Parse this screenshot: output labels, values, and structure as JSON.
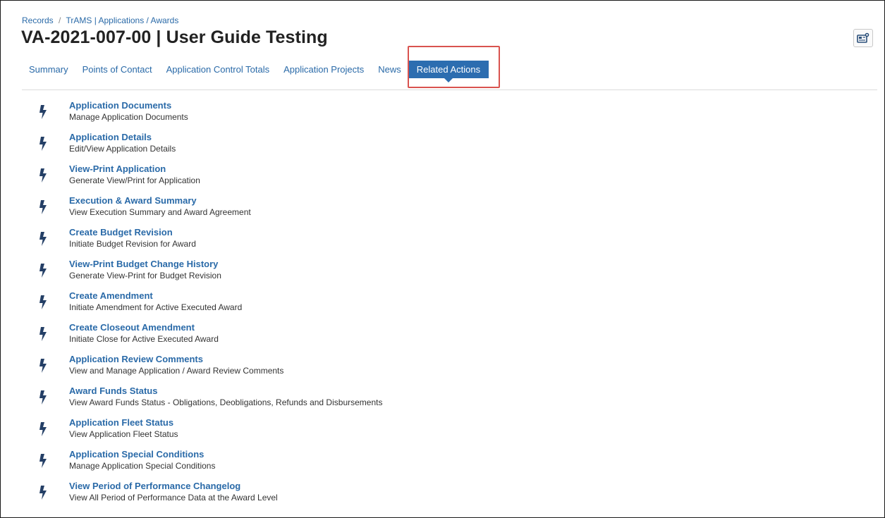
{
  "breadcrumb": {
    "items": [
      "Records",
      "TrAMS | Applications / Awards"
    ],
    "separator": "/"
  },
  "page_title": "VA-2021-007-00 | User Guide Testing",
  "news_button_icon": "news-icon",
  "tabs": [
    {
      "label": "Summary",
      "active": false
    },
    {
      "label": "Points of Contact",
      "active": false
    },
    {
      "label": "Application Control Totals",
      "active": false
    },
    {
      "label": "Application Projects",
      "active": false
    },
    {
      "label": "News",
      "active": false
    },
    {
      "label": "Related Actions",
      "active": true
    }
  ],
  "colors": {
    "link": "#2a6aa8",
    "active_tab": "#2c6db0",
    "highlight": "#d9534f",
    "bolt": "#243f66"
  },
  "related_actions": [
    {
      "title": "Application Documents",
      "description": "Manage Application Documents"
    },
    {
      "title": "Application Details",
      "description": "Edit/View Application Details"
    },
    {
      "title": "View-Print Application",
      "description": "Generate View/Print for Application"
    },
    {
      "title": "Execution & Award Summary",
      "description": "View Execution Summary and Award Agreement"
    },
    {
      "title": "Create Budget Revision",
      "description": "Initiate Budget Revision for Award"
    },
    {
      "title": "View-Print Budget Change History",
      "description": "Generate View-Print for Budget Revision"
    },
    {
      "title": "Create Amendment",
      "description": "Initiate Amendment for Active Executed Award"
    },
    {
      "title": "Create Closeout Amendment",
      "description": "Initiate Close for  Active Executed Award"
    },
    {
      "title": "Application Review Comments",
      "description": "View and Manage Application / Award Review Comments"
    },
    {
      "title": "Award Funds Status",
      "description": "View Award Funds Status - Obligations, Deobligations, Refunds and Disbursements"
    },
    {
      "title": "Application Fleet Status",
      "description": "View Application Fleet Status"
    },
    {
      "title": "Application Special Conditions",
      "description": "Manage Application Special Conditions"
    },
    {
      "title": "View Period of Performance Changelog",
      "description": "View All Period of Performance Data at the Award Level"
    }
  ]
}
